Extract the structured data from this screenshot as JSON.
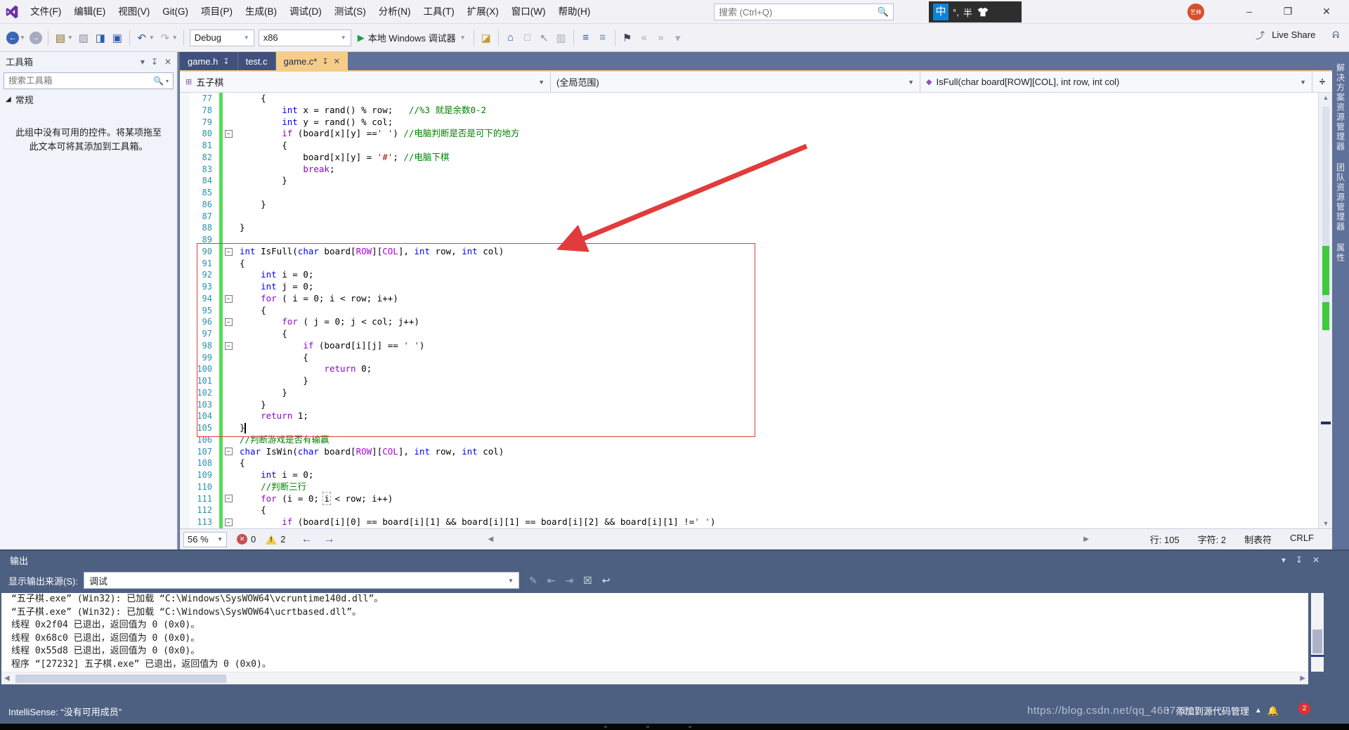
{
  "colors": {
    "accent_tab": "#F5CD88",
    "chrome": "#5F7199",
    "panel_chrome": "#4D6082",
    "change_bar_green": "#53DD53",
    "annotation_red": "#E23B3B",
    "keyword_blue": "#0000FF",
    "control_purple": "#8F08C4",
    "macro_purple": "#AF00DB",
    "char_literal_red": "#A31515",
    "comment_green": "#008000",
    "line_number_teal": "#2B91AF"
  },
  "titlebar": {
    "menu_items": [
      "文件(F)",
      "编辑(E)",
      "视图(V)",
      "Git(G)",
      "项目(P)",
      "生成(B)",
      "调试(D)",
      "测试(S)",
      "分析(N)",
      "工具(T)",
      "扩展(X)",
      "窗口(W)",
      "帮助(H)"
    ],
    "search_placeholder": "搜索 (Ctrl+Q)",
    "ime_lang": "中",
    "ime_punct": "°,",
    "ime_half": "半",
    "avatar_text": "艺林",
    "minimize": "–",
    "maximize": "❐",
    "close": "✕"
  },
  "toolbar": {
    "config": "Debug",
    "platform": "x86",
    "run_label": "本地 Windows 调试器",
    "live_share_label": "Live Share",
    "icons": [
      {
        "name": "nav-back-icon",
        "g": "←",
        "c": "#ffffff",
        "bg": "#3A66B5",
        "dd": true
      },
      {
        "name": "nav-forward-icon",
        "g": "→",
        "c": "#ffffff",
        "bg": "#A6ABBD"
      },
      {
        "sep": true
      },
      {
        "name": "new-project-icon",
        "g": "▤",
        "c": "#8A6D1F",
        "dd": true
      },
      {
        "name": "add-item-icon",
        "g": "▨",
        "c": "#8A8FA0"
      },
      {
        "name": "save-icon",
        "g": "◨",
        "c": "#2B5DAD"
      },
      {
        "name": "save-all-icon",
        "g": "▣",
        "c": "#2B5DAD"
      },
      {
        "sep": true
      },
      {
        "name": "undo-icon",
        "g": "↶",
        "c": "#2B5DAD",
        "dd": true
      },
      {
        "name": "redo-icon",
        "g": "↷",
        "c": "#A6ABBD",
        "dd": true
      },
      {
        "sep": true
      },
      {
        "combo": "config"
      },
      {
        "combo": "platform"
      },
      {
        "run": true
      },
      {
        "sep": true
      },
      {
        "name": "folder-search-icon",
        "g": "◪",
        "c": "#C59A2F"
      },
      {
        "sep": true
      },
      {
        "name": "home-window-icon",
        "g": "⌂",
        "c": "#2B5DAD"
      },
      {
        "name": "frame-icon",
        "g": "□",
        "c": "#A6ABBD"
      },
      {
        "name": "pointer-icon",
        "g": "↖",
        "c": "#8A8FA0"
      },
      {
        "name": "paste-icon",
        "g": "▥",
        "c": "#A6ABBD"
      },
      {
        "sep": true
      },
      {
        "name": "indent-out-icon",
        "g": "≡",
        "c": "#2B5DAD"
      },
      {
        "name": "indent-in-icon",
        "g": "≡",
        "c": "#6A87C0"
      },
      {
        "sep": true
      },
      {
        "name": "bookmark-icon",
        "g": "⚑",
        "c": "#3C4258"
      },
      {
        "name": "prev-bookmark-icon",
        "g": "«",
        "c": "#A6ABBD"
      },
      {
        "name": "next-bookmark-icon",
        "g": "»",
        "c": "#A6ABBD"
      },
      {
        "name": "bookmark-more-icon",
        "g": "▾",
        "c": "#A6ABBD"
      }
    ]
  },
  "toolbox": {
    "title": "工具箱",
    "search_placeholder": "搜索工具箱",
    "section_label": "常规",
    "empty_text": "此组中没有可用的控件。将某项拖至此文本可将其添加到工具箱。"
  },
  "editor": {
    "tabs": [
      {
        "label": "game.h",
        "pinned": true,
        "active": false,
        "closeable": false
      },
      {
        "label": "test.c",
        "pinned": false,
        "active": false,
        "closeable": false
      },
      {
        "label": "game.c*",
        "pinned": true,
        "active": true,
        "closeable": true
      }
    ],
    "nav": {
      "project": "五子棋",
      "scope": "(全局范围)",
      "member": "IsFull(char board[ROW][COL], int row, int col)"
    },
    "lines": [
      [
        77,
        0,
        [
          [
            "p",
            "    {"
          ]
        ]
      ],
      [
        78,
        0,
        [
          [
            "p",
            "        "
          ],
          [
            "k",
            "int"
          ],
          [
            "p",
            " x = rand() % row;   "
          ],
          [
            "cm",
            "//%3 就是余数0-2"
          ]
        ]
      ],
      [
        79,
        0,
        [
          [
            "p",
            "        "
          ],
          [
            "k",
            "int"
          ],
          [
            "p",
            " y = rand() % col;"
          ]
        ]
      ],
      [
        80,
        1,
        [
          [
            "p",
            "        "
          ],
          [
            "c",
            "if"
          ],
          [
            "p",
            " (board[x][y] =="
          ],
          [
            "s",
            "' '"
          ],
          [
            "p",
            ") "
          ],
          [
            "cm",
            "//电脑判断是否是可下的地方"
          ]
        ]
      ],
      [
        81,
        0,
        [
          [
            "p",
            "        {"
          ]
        ]
      ],
      [
        82,
        0,
        [
          [
            "p",
            "            board[x][y] = "
          ],
          [
            "s",
            "'#'"
          ],
          [
            "p",
            "; "
          ],
          [
            "cm",
            "//电脑下棋"
          ]
        ]
      ],
      [
        83,
        0,
        [
          [
            "p",
            "            "
          ],
          [
            "c",
            "break"
          ],
          [
            "p",
            ";"
          ]
        ]
      ],
      [
        84,
        0,
        [
          [
            "p",
            "        }"
          ]
        ]
      ],
      [
        85,
        0,
        []
      ],
      [
        86,
        0,
        [
          [
            "p",
            "    }"
          ]
        ]
      ],
      [
        87,
        0,
        []
      ],
      [
        88,
        0,
        [
          [
            "p",
            "}"
          ]
        ]
      ],
      [
        89,
        0,
        []
      ],
      [
        90,
        1,
        [
          [
            "k",
            "int"
          ],
          [
            "p",
            " IsFull("
          ],
          [
            "k",
            "char"
          ],
          [
            "p",
            " board["
          ],
          [
            "m",
            "ROW"
          ],
          [
            "p",
            "]["
          ],
          [
            "m",
            "COL"
          ],
          [
            "p",
            "], "
          ],
          [
            "k",
            "int"
          ],
          [
            "p",
            " row, "
          ],
          [
            "k",
            "int"
          ],
          [
            "p",
            " col)"
          ]
        ]
      ],
      [
        91,
        0,
        [
          [
            "p",
            "{"
          ]
        ]
      ],
      [
        92,
        0,
        [
          [
            "p",
            "    "
          ],
          [
            "k",
            "int"
          ],
          [
            "p",
            " i = 0;"
          ]
        ]
      ],
      [
        93,
        0,
        [
          [
            "p",
            "    "
          ],
          [
            "k",
            "int"
          ],
          [
            "p",
            " j = 0;"
          ]
        ]
      ],
      [
        94,
        1,
        [
          [
            "p",
            "    "
          ],
          [
            "c",
            "for"
          ],
          [
            "p",
            " ( i = 0; i < row; i++)"
          ]
        ]
      ],
      [
        95,
        0,
        [
          [
            "p",
            "    {"
          ]
        ]
      ],
      [
        96,
        1,
        [
          [
            "p",
            "        "
          ],
          [
            "c",
            "for"
          ],
          [
            "p",
            " ( j = 0; j < col; j++)"
          ]
        ]
      ],
      [
        97,
        0,
        [
          [
            "p",
            "        {"
          ]
        ]
      ],
      [
        98,
        1,
        [
          [
            "p",
            "            "
          ],
          [
            "c",
            "if"
          ],
          [
            "p",
            " (board[i][j] == "
          ],
          [
            "s",
            "' '"
          ],
          [
            "p",
            ")"
          ]
        ]
      ],
      [
        99,
        0,
        [
          [
            "p",
            "            {"
          ]
        ]
      ],
      [
        100,
        0,
        [
          [
            "p",
            "                "
          ],
          [
            "c",
            "return"
          ],
          [
            "p",
            " 0;"
          ]
        ]
      ],
      [
        101,
        0,
        [
          [
            "p",
            "            }"
          ]
        ]
      ],
      [
        102,
        0,
        [
          [
            "p",
            "        }"
          ]
        ]
      ],
      [
        103,
        0,
        [
          [
            "p",
            "    }"
          ]
        ]
      ],
      [
        104,
        0,
        [
          [
            "p",
            "    "
          ],
          [
            "c",
            "return"
          ],
          [
            "p",
            " 1;"
          ]
        ]
      ],
      [
        105,
        0,
        [
          [
            "p",
            "}"
          ]
        ]
      ],
      [
        106,
        0,
        [
          [
            "cm",
            "//判断游戏是否有输赢"
          ]
        ]
      ],
      [
        107,
        1,
        [
          [
            "k",
            "char"
          ],
          [
            "p",
            " IsWin("
          ],
          [
            "k",
            "char"
          ],
          [
            "p",
            " board["
          ],
          [
            "m",
            "ROW"
          ],
          [
            "p",
            "]["
          ],
          [
            "m",
            "COL"
          ],
          [
            "p",
            "], "
          ],
          [
            "k",
            "int"
          ],
          [
            "p",
            " row, "
          ],
          [
            "k",
            "int"
          ],
          [
            "p",
            " col)"
          ]
        ]
      ],
      [
        108,
        0,
        [
          [
            "p",
            "{"
          ]
        ]
      ],
      [
        109,
        0,
        [
          [
            "p",
            "    "
          ],
          [
            "k",
            "int"
          ],
          [
            "p",
            " i = 0;"
          ]
        ]
      ],
      [
        110,
        0,
        [
          [
            "p",
            "    "
          ],
          [
            "cm",
            "//判断三行"
          ]
        ]
      ],
      [
        111,
        1,
        [
          [
            "p",
            "    "
          ],
          [
            "c",
            "for"
          ],
          [
            "p",
            " (i = 0; "
          ],
          [
            "box",
            "i"
          ],
          [
            "p",
            " < row; i++)"
          ]
        ]
      ],
      [
        112,
        0,
        [
          [
            "p",
            "    {"
          ]
        ]
      ],
      [
        113,
        1,
        [
          [
            "p",
            "        "
          ],
          [
            "c",
            "if"
          ],
          [
            "p",
            " (board[i][0] == board[i][1] && board[i][1] == board[i][2] && board[i][1] !="
          ],
          [
            "s",
            "' '"
          ],
          [
            "p",
            ")"
          ]
        ]
      ]
    ],
    "status": {
      "zoom": "56 %",
      "error_count": "0",
      "warning_count": "2",
      "line": "行: 105",
      "column": "字符: 2",
      "tabs": "制表符",
      "eol": "CRLF"
    }
  },
  "right_strip": {
    "labels": [
      "解决方案资源管理器",
      "团队资源管理器",
      "属性"
    ]
  },
  "output": {
    "title": "输出",
    "source_label": "显示输出来源(S):",
    "source_value": "调试",
    "icons": [
      {
        "name": "message-pencil-icon",
        "g": "✎",
        "c": "#A6ABBD"
      },
      {
        "name": "prev-message-icon",
        "g": "⇤",
        "c": "#A6ABBD"
      },
      {
        "name": "next-message-icon",
        "g": "⇥",
        "c": "#A6ABBD"
      },
      {
        "name": "clear-all-icon",
        "g": "☒",
        "c": "#E4E7F0"
      },
      {
        "name": "word-wrap-icon",
        "g": "↩",
        "c": "#E4E7F0"
      }
    ],
    "lines": [
      "“五子棋.exe” (Win32): 已加载 “C:\\Windows\\SysWOW64\\vcruntime140d.dll”。",
      "“五子棋.exe” (Win32): 已加载 “C:\\Windows\\SysWOW64\\ucrtbased.dll”。",
      "线程 0x2f04 已退出，返回值为 0 (0x0)。",
      "线程 0x68c0 已退出，返回值为 0 (0x0)。",
      "线程 0x55d8 已退出，返回值为 0 (0x0)。",
      "程序 “[27232] 五子棋.exe” 已退出，返回值为 0 (0x0)。"
    ]
  },
  "status_bar": {
    "message": "IntelliSense: “没有可用成员”",
    "scm_label": "添加到源代码管理",
    "badge": "2",
    "watermark": "https://blog.csdn.net/qq_46874327"
  }
}
